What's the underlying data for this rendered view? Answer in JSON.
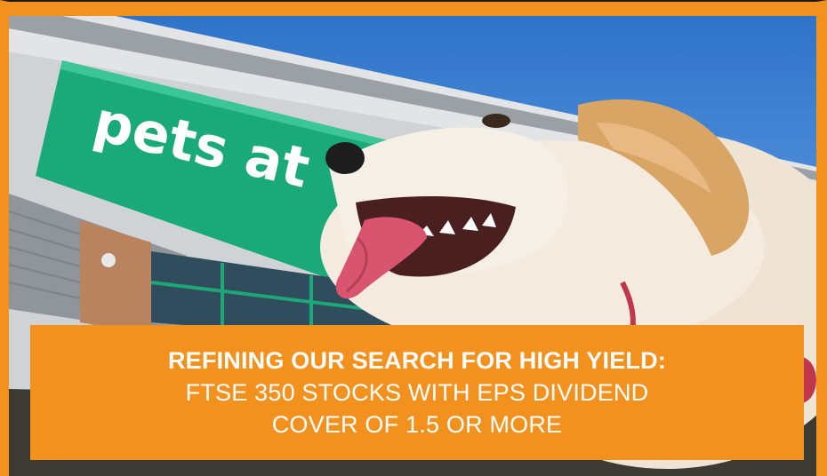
{
  "photo": {
    "storefront_sign_text": "pets at",
    "subject": "golden retriever dog with tongue out in front of store"
  },
  "caption": {
    "line1": "REFINING OUR SEARCH FOR HIGH YIELD:",
    "line2": "FTSE 350 STOCKS WITH EPS DIVIDEND",
    "line3": "COVER OF 1.5 OR MORE"
  },
  "colors": {
    "frame_orange": "#f3911f",
    "sign_green": "#1aa978",
    "sky_blue": "#3d82d3"
  }
}
